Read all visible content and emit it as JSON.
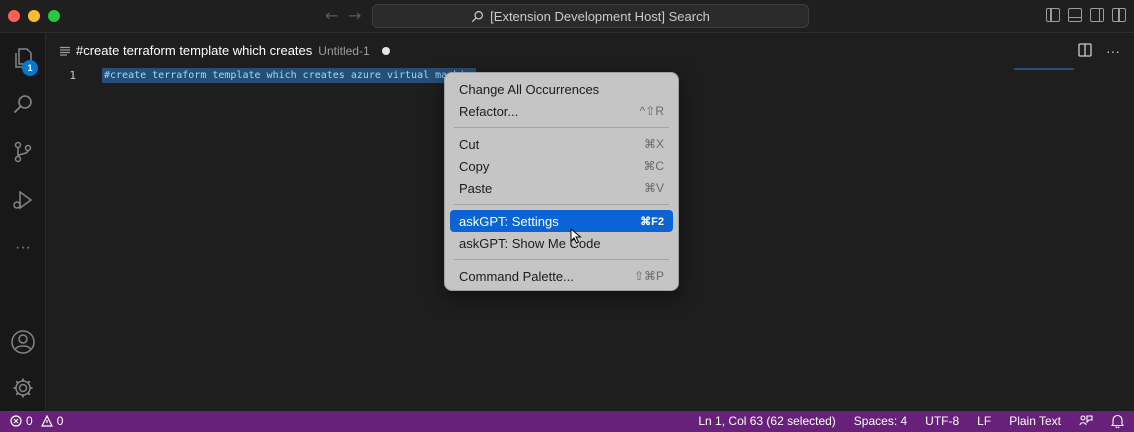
{
  "titlebar": {
    "search_text": "[Extension Development Host] Search"
  },
  "activity": {
    "explorer_badge": "1",
    "more": "···"
  },
  "tab": {
    "title": "#create terraform template which creates",
    "subtitle": "Untitled-1"
  },
  "editor": {
    "line_number": "1",
    "code_text": "#create terraform template which creates azure virtual machine"
  },
  "context_menu": {
    "items": [
      {
        "label": "Change All Occurrences",
        "shortcut": ""
      },
      {
        "label": "Refactor...",
        "shortcut": "^⇧R"
      },
      {
        "label": "Cut",
        "shortcut": "⌘X"
      },
      {
        "label": "Copy",
        "shortcut": "⌘C"
      },
      {
        "label": "Paste",
        "shortcut": "⌘V"
      },
      {
        "label": "askGPT: Settings",
        "shortcut": "⌘F2"
      },
      {
        "label": "askGPT: Show Me Code",
        "shortcut": ""
      },
      {
        "label": "Command Palette...",
        "shortcut": "⇧⌘P"
      }
    ]
  },
  "statusbar": {
    "errors": "0",
    "warnings": "0",
    "position": "Ln 1, Col 63 (62 selected)",
    "spaces": "Spaces: 4",
    "encoding": "UTF-8",
    "eol": "LF",
    "language": "Plain Text"
  },
  "colors": {
    "status_bar": "#68217a",
    "selection": "#264f78",
    "menu_highlight": "#0a64d6",
    "badge": "#0078d4"
  }
}
